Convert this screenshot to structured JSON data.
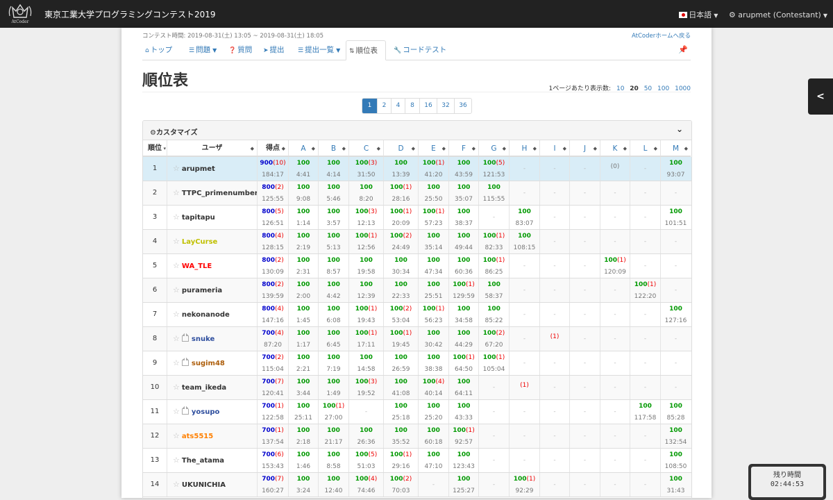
{
  "navbar": {
    "logo_text": "AtCoder",
    "brand": "東京工業大学プログラミングコンテスト2019",
    "language": "日本語",
    "user": "arupmet (Contestant)"
  },
  "contest": {
    "time": "コンテスト時間: 2019-08-31(土) 13:05 ~ 2019-08-31(土) 18:05",
    "home_link": "AtCoderホームへ戻る"
  },
  "tabs": [
    {
      "label": "トップ",
      "icon": "home-icon"
    },
    {
      "label": "問題",
      "icon": "list-icon",
      "dropdown": true
    },
    {
      "label": "質問",
      "icon": "question-icon"
    },
    {
      "label": "提出",
      "icon": "send-icon"
    },
    {
      "label": "提出一覧",
      "icon": "list-icon",
      "dropdown": true
    },
    {
      "label": "順位表",
      "icon": "sort-icon",
      "active": true
    },
    {
      "label": "コードテスト",
      "icon": "wrench-icon"
    }
  ],
  "page_title": "順位表",
  "per_page": {
    "label": "1ページあたり表示数:",
    "options": [
      "10",
      "20",
      "50",
      "100",
      "1000"
    ],
    "selected": "20"
  },
  "pagination": {
    "pages": [
      "1",
      "2",
      "4",
      "8",
      "16",
      "32",
      "36"
    ],
    "current": "1"
  },
  "customize_label": "カスタマイズ",
  "table": {
    "headers": {
      "rank": "順位",
      "user": "ユーザ",
      "score": "得点"
    },
    "problems": [
      "A",
      "B",
      "C",
      "D",
      "E",
      "F",
      "G",
      "H",
      "I",
      "J",
      "K",
      "L",
      "M"
    ],
    "rows": [
      {
        "rank": "1",
        "user": "arupmet",
        "color": "gray",
        "crown": false,
        "total": {
          "s": "900",
          "p": "(10)",
          "t": "184:17"
        },
        "cells": [
          {
            "s": "100",
            "t": "4:41"
          },
          {
            "s": "100",
            "t": "4:14"
          },
          {
            "s": "100",
            "p": "(3)",
            "t": "31:50"
          },
          {
            "s": "100",
            "t": "13:39"
          },
          {
            "s": "100",
            "p": "(1)",
            "t": "41:20"
          },
          {
            "s": "100",
            "t": "43:59"
          },
          {
            "s": "100",
            "p": "(5)",
            "t": "121:53"
          },
          null,
          null,
          null,
          {
            "x": "(0)"
          },
          null,
          {
            "s": "100",
            "t": "93:07"
          }
        ]
      },
      {
        "rank": "2",
        "user": "TTPC_primenumber",
        "color": "gray",
        "crown": false,
        "total": {
          "s": "800",
          "p": "(2)",
          "t": "125:55"
        },
        "cells": [
          {
            "s": "100",
            "t": "9:08"
          },
          {
            "s": "100",
            "t": "5:46"
          },
          {
            "s": "100",
            "t": "8:20"
          },
          {
            "s": "100",
            "p": "(1)",
            "t": "28:16"
          },
          {
            "s": "100",
            "t": "25:50"
          },
          {
            "s": "100",
            "t": "35:07"
          },
          {
            "s": "100",
            "t": "115:55"
          },
          null,
          null,
          null,
          null,
          null,
          null
        ]
      },
      {
        "rank": "3",
        "user": "tapitapu",
        "color": "gray",
        "crown": false,
        "total": {
          "s": "800",
          "p": "(5)",
          "t": "126:51"
        },
        "cells": [
          {
            "s": "100",
            "t": "1:14"
          },
          {
            "s": "100",
            "t": "3:57"
          },
          {
            "s": "100",
            "p": "(3)",
            "t": "12:13"
          },
          {
            "s": "100",
            "p": "(1)",
            "t": "20:09"
          },
          {
            "s": "100",
            "p": "(1)",
            "t": "57:23"
          },
          {
            "s": "100",
            "t": "38:37"
          },
          null,
          {
            "s": "100",
            "t": "83:07"
          },
          null,
          null,
          null,
          null,
          {
            "s": "100",
            "t": "101:51"
          }
        ]
      },
      {
        "rank": "4",
        "user": "LayCurse",
        "color": "yellow",
        "crown": false,
        "total": {
          "s": "800",
          "p": "(4)",
          "t": "128:15"
        },
        "cells": [
          {
            "s": "100",
            "t": "2:19"
          },
          {
            "s": "100",
            "t": "5:13"
          },
          {
            "s": "100",
            "p": "(1)",
            "t": "12:56"
          },
          {
            "s": "100",
            "p": "(2)",
            "t": "24:49"
          },
          {
            "s": "100",
            "t": "35:14"
          },
          {
            "s": "100",
            "t": "49:44"
          },
          {
            "s": "100",
            "p": "(1)",
            "t": "82:33"
          },
          {
            "s": "100",
            "t": "108:15"
          },
          null,
          null,
          null,
          null,
          null
        ]
      },
      {
        "rank": "5",
        "user": "WA_TLE",
        "color": "red",
        "crown": false,
        "total": {
          "s": "800",
          "p": "(2)",
          "t": "130:09"
        },
        "cells": [
          {
            "s": "100",
            "t": "2:31"
          },
          {
            "s": "100",
            "t": "8:57"
          },
          {
            "s": "100",
            "t": "19:58"
          },
          {
            "s": "100",
            "t": "30:34"
          },
          {
            "s": "100",
            "t": "47:34"
          },
          {
            "s": "100",
            "t": "60:36"
          },
          {
            "s": "100",
            "p": "(1)",
            "t": "86:25"
          },
          null,
          null,
          null,
          {
            "s": "100",
            "p": "(1)",
            "t": "120:09"
          },
          null,
          null
        ]
      },
      {
        "rank": "6",
        "user": "purameria",
        "color": "gray",
        "crown": false,
        "total": {
          "s": "800",
          "p": "(2)",
          "t": "139:59"
        },
        "cells": [
          {
            "s": "100",
            "t": "2:00"
          },
          {
            "s": "100",
            "t": "4:42"
          },
          {
            "s": "100",
            "t": "12:39"
          },
          {
            "s": "100",
            "t": "22:33"
          },
          {
            "s": "100",
            "t": "25:51"
          },
          {
            "s": "100",
            "p": "(1)",
            "t": "129:59"
          },
          {
            "s": "100",
            "t": "58:37"
          },
          null,
          null,
          null,
          null,
          {
            "s": "100",
            "p": "(1)",
            "t": "122:20"
          },
          null
        ]
      },
      {
        "rank": "7",
        "user": "nekonanode",
        "color": "gray",
        "crown": false,
        "total": {
          "s": "800",
          "p": "(4)",
          "t": "147:16"
        },
        "cells": [
          {
            "s": "100",
            "t": "1:45"
          },
          {
            "s": "100",
            "t": "6:08"
          },
          {
            "s": "100",
            "p": "(1)",
            "t": "19:43"
          },
          {
            "s": "100",
            "p": "(2)",
            "t": "53:04"
          },
          {
            "s": "100",
            "p": "(1)",
            "t": "56:23"
          },
          {
            "s": "100",
            "t": "34:58"
          },
          {
            "s": "100",
            "t": "85:22"
          },
          null,
          null,
          null,
          null,
          null,
          {
            "s": "100",
            "t": "127:16"
          }
        ]
      },
      {
        "rank": "8",
        "user": "snuke",
        "color": "navy",
        "crown": true,
        "total": {
          "s": "700",
          "p": "(4)",
          "t": "87:20"
        },
        "cells": [
          {
            "s": "100",
            "t": "1:17"
          },
          {
            "s": "100",
            "t": "6:45"
          },
          {
            "s": "100",
            "p": "(1)",
            "t": "17:11"
          },
          {
            "s": "100",
            "p": "(1)",
            "t": "19:45"
          },
          {
            "s": "100",
            "t": "30:42"
          },
          {
            "s": "100",
            "t": "44:29"
          },
          {
            "s": "100",
            "p": "(2)",
            "t": "67:20"
          },
          null,
          {
            "x": "(1)"
          },
          null,
          null,
          null,
          null
        ]
      },
      {
        "rank": "9",
        "user": "sugim48",
        "color": "brown",
        "crown": true,
        "total": {
          "s": "700",
          "p": "(2)",
          "t": "115:04"
        },
        "cells": [
          {
            "s": "100",
            "t": "2:21"
          },
          {
            "s": "100",
            "t": "7:19"
          },
          {
            "s": "100",
            "t": "14:58"
          },
          {
            "s": "100",
            "t": "26:59"
          },
          {
            "s": "100",
            "t": "38:38"
          },
          {
            "s": "100",
            "p": "(1)",
            "t": "64:50"
          },
          {
            "s": "100",
            "p": "(1)",
            "t": "105:04"
          },
          null,
          null,
          null,
          null,
          null,
          null
        ]
      },
      {
        "rank": "10",
        "user": "team_ikeda",
        "color": "gray",
        "crown": false,
        "total": {
          "s": "700",
          "p": "(7)",
          "t": "120:41"
        },
        "cells": [
          {
            "s": "100",
            "t": "3:44"
          },
          {
            "s": "100",
            "t": "1:49"
          },
          {
            "s": "100",
            "p": "(3)",
            "t": "19:52"
          },
          {
            "s": "100",
            "t": "41:08"
          },
          {
            "s": "100",
            "p": "(4)",
            "t": "40:14"
          },
          {
            "s": "100",
            "t": "64:11"
          },
          null,
          {
            "x": "(1)"
          },
          null,
          null,
          null,
          null,
          null
        ]
      },
      {
        "rank": "11",
        "user": "yosupo",
        "color": "navy",
        "crown": true,
        "total": {
          "s": "700",
          "p": "(1)",
          "t": "122:58"
        },
        "cells": [
          {
            "s": "100",
            "t": "25:11"
          },
          {
            "s": "100",
            "p": "(1)",
            "t": "27:00"
          },
          null,
          {
            "s": "100",
            "t": "25:18"
          },
          {
            "s": "100",
            "t": "25:20"
          },
          {
            "s": "100",
            "t": "43:33"
          },
          null,
          null,
          null,
          null,
          null,
          {
            "s": "100",
            "t": "117:58"
          },
          {
            "s": "100",
            "t": "85:28"
          }
        ]
      },
      {
        "rank": "12",
        "user": "ats5515",
        "color": "orange",
        "crown": false,
        "total": {
          "s": "700",
          "p": "(1)",
          "t": "137:54"
        },
        "cells": [
          {
            "s": "100",
            "t": "2:18"
          },
          {
            "s": "100",
            "t": "21:17"
          },
          {
            "s": "100",
            "t": "26:36"
          },
          {
            "s": "100",
            "t": "35:52"
          },
          {
            "s": "100",
            "t": "60:18"
          },
          {
            "s": "100",
            "p": "(1)",
            "t": "92:57"
          },
          null,
          null,
          null,
          null,
          null,
          null,
          {
            "s": "100",
            "t": "132:54"
          }
        ]
      },
      {
        "rank": "13",
        "user": "The_atama",
        "color": "gray",
        "crown": false,
        "total": {
          "s": "700",
          "p": "(6)",
          "t": "153:43"
        },
        "cells": [
          {
            "s": "100",
            "t": "1:46"
          },
          {
            "s": "100",
            "t": "8:58"
          },
          {
            "s": "100",
            "p": "(5)",
            "t": "51:03"
          },
          {
            "s": "100",
            "p": "(1)",
            "t": "29:16"
          },
          {
            "s": "100",
            "t": "47:10"
          },
          {
            "s": "100",
            "t": "123:43"
          },
          null,
          null,
          null,
          null,
          null,
          null,
          {
            "s": "100",
            "t": "108:50"
          }
        ]
      },
      {
        "rank": "14",
        "user": "UKUNICHIA",
        "color": "gray",
        "crown": false,
        "total": {
          "s": "700",
          "p": "(7)",
          "t": "160:27"
        },
        "cells": [
          {
            "s": "100",
            "t": "3:24"
          },
          {
            "s": "100",
            "t": "12:40"
          },
          {
            "s": "100",
            "p": "(4)",
            "t": "74:46"
          },
          {
            "s": "100",
            "p": "(2)",
            "t": "70:03"
          },
          null,
          {
            "s": "100",
            "t": "125:27"
          },
          null,
          {
            "s": "100",
            "p": "(1)",
            "t": "92:29"
          },
          null,
          null,
          null,
          null,
          {
            "s": "100",
            "t": "31:43"
          }
        ]
      }
    ],
    "empty_mark": "-"
  },
  "timer": {
    "label": "残り時間",
    "value": "02:44:53"
  }
}
